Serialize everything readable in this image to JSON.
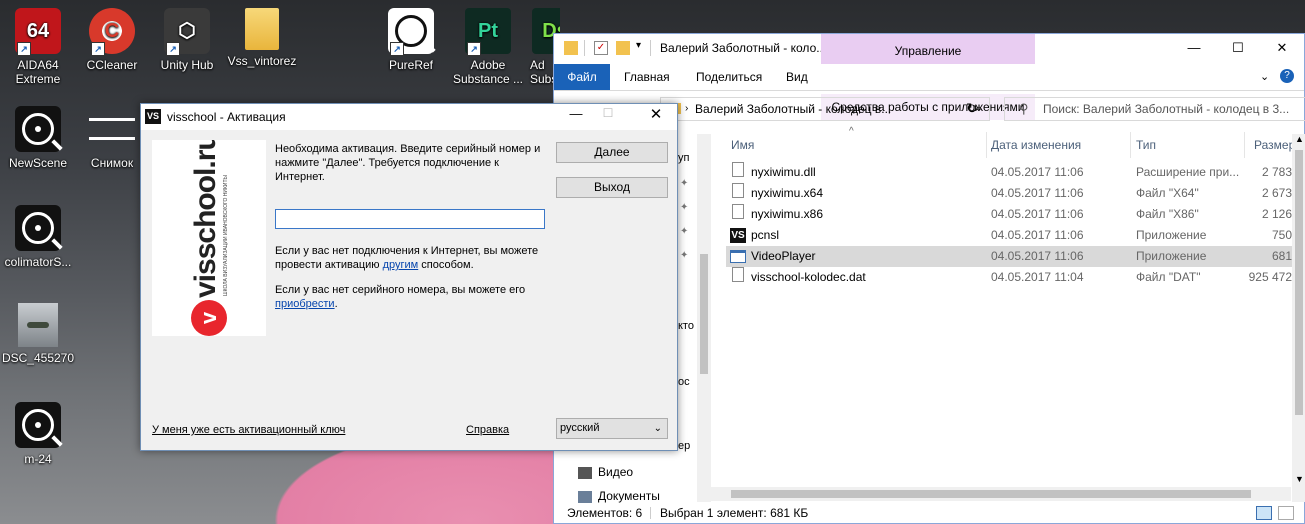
{
  "desktop": {
    "icons": [
      {
        "label": "AIDA64\nExtreme",
        "glyph": "64",
        "color": "#c0161b"
      },
      {
        "label": "CCleaner",
        "glyph": "C",
        "color": "#d8392b"
      },
      {
        "label": "Unity Hub",
        "glyph": "⬡",
        "color": "#3a3a3a"
      },
      {
        "label": "Vss_vintorez",
        "glyph": "",
        "color": "#f2c24f"
      },
      {
        "label": "PureRef",
        "glyph": "",
        "color": "#111111"
      },
      {
        "label": "Adobe\nSubstance ...",
        "glyph": "Pt",
        "color": "#0f3b2e"
      },
      {
        "label": "Ad\nSubs",
        "glyph": "Ds",
        "color": "#0f3b2e"
      },
      {
        "label": "NewScene",
        "glyph": "",
        "color": "#111111"
      },
      {
        "label": "Снимок",
        "glyph": "",
        "color": "#ffffff"
      },
      {
        "label": "colimatorS...",
        "glyph": "",
        "color": "#111111"
      },
      {
        "label": "DSC_455270",
        "glyph": "",
        "color": "#9aa0a4"
      },
      {
        "label": "m-24",
        "glyph": "",
        "color": "#111111"
      }
    ]
  },
  "explorer": {
    "title": "Валерий Заболотный - коло...",
    "ribbon": {
      "context_header": "Управление",
      "tabs": [
        "Файл",
        "Главная",
        "Поделиться",
        "Вид"
      ],
      "context_tab": "Средства работы с приложениями"
    },
    "address": "Валерий Заболотный - колодец в...",
    "search_placeholder": "Поиск: Валерий Заболотный - колодец в 3...",
    "columns": {
      "name": "Имя",
      "date": "Дата изменения",
      "type": "Тип",
      "size": "Размер"
    },
    "files": [
      {
        "name": "nyxiwimu.dll",
        "date": "04.05.2017 11:06",
        "type": "Расширение при...",
        "size": "2 783",
        "icon": "dll-file-icon",
        "selected": false
      },
      {
        "name": "nyxiwimu.x64",
        "date": "04.05.2017 11:06",
        "type": "Файл \"X64\"",
        "size": "2 673",
        "icon": "file-icon",
        "selected": false
      },
      {
        "name": "nyxiwimu.x86",
        "date": "04.05.2017 11:06",
        "type": "Файл \"X86\"",
        "size": "2 126",
        "icon": "file-icon",
        "selected": false
      },
      {
        "name": "pcnsl",
        "date": "04.05.2017 11:06",
        "type": "Приложение",
        "size": "750",
        "icon": "vs-app-icon",
        "selected": false
      },
      {
        "name": "VideoPlayer",
        "date": "04.05.2017 11:06",
        "type": "Приложение",
        "size": "681",
        "icon": "app-window-icon",
        "selected": true
      },
      {
        "name": "visschool-kolodec.dat",
        "date": "04.05.2017 11:04",
        "type": "Файл \"DAT\"",
        "size": "925 472",
        "icon": "file-icon",
        "selected": false
      }
    ],
    "nav_fragments": [
      "уп",
      "кто",
      "ос",
      "ер"
    ],
    "nav_items": [
      {
        "label": "Видео",
        "icon": "video-folder-icon"
      },
      {
        "label": "Документы",
        "icon": "documents-folder-icon"
      }
    ],
    "status": {
      "count": "Элементов: 6",
      "selection": "Выбран 1 элемент: 681 КБ"
    }
  },
  "dialog": {
    "title": "visschool - Активация",
    "intro": "Необходима активация. Введите серийный номер и нажмите \"Далее\". Требуется подключение к Интернет.",
    "next_button": "Далее",
    "exit_button": "Выход",
    "serial_value": "",
    "offline_text_before": "Если у вас нет подключения к Интернет, вы можете провести активацию ",
    "offline_link": "другим",
    "offline_text_after": " способом.",
    "buy_text_before": "Если у вас нет серийного номера, вы можете его ",
    "buy_link": "приобрести",
    "buy_text_after": ".",
    "have_key_link": "У меня уже есть активационный ключ",
    "help_link": "Справка",
    "language": "русский",
    "logo_text": "visschool.ru",
    "logo_subtext": "ШКОЛА ВИЗУАЛИЗАЦИИ ИВАНОВСКОГО НИКИТЫ"
  }
}
